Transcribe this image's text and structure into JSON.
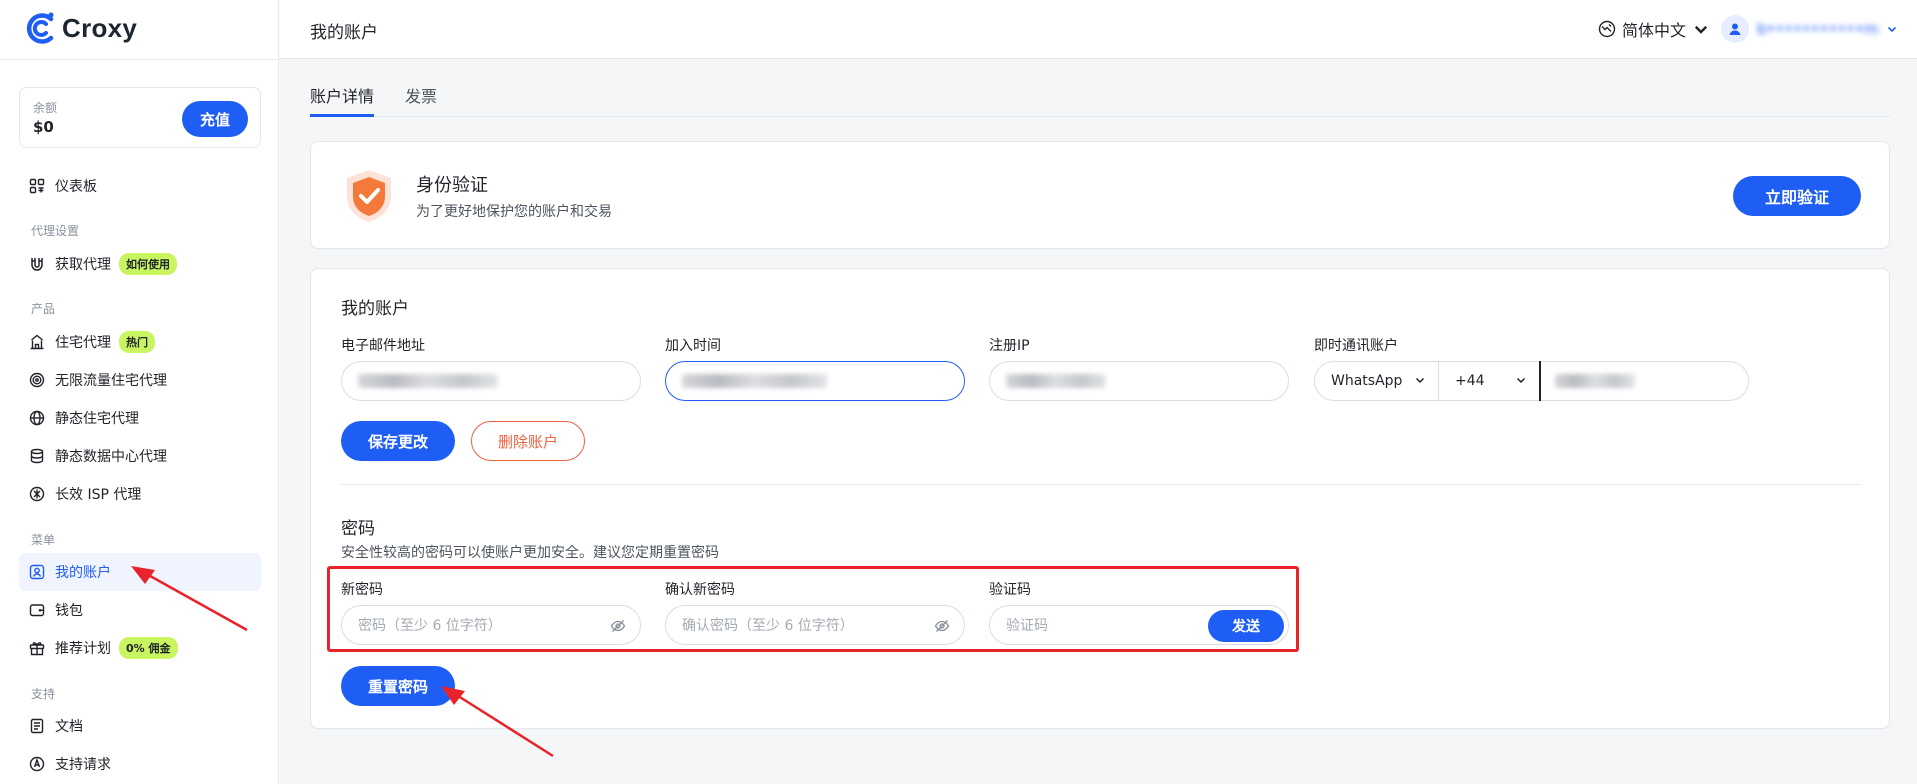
{
  "brand": {
    "name": "Croxy"
  },
  "balance": {
    "label": "余额",
    "value": "$0",
    "recharge_label": "充值"
  },
  "nav": {
    "dashboard": "仪表板",
    "section_proxy": "代理设置",
    "get_proxy": "获取代理",
    "get_proxy_tag": "如何使用",
    "section_product": "产品",
    "residential": "住宅代理",
    "residential_tag": "热门",
    "unlimited": "无限流量住宅代理",
    "static_residential": "静态住宅代理",
    "static_datacenter": "静态数据中心代理",
    "isp": "长效 ISP 代理",
    "section_menu": "菜单",
    "my_account": "我的账户",
    "wallet": "钱包",
    "referral": "推荐计划",
    "referral_tag": "0% 佣金",
    "section_support": "支持",
    "docs": "文档",
    "support": "支持请求"
  },
  "header": {
    "title": "我的账户",
    "language": "简体中文",
    "user_email": "b•••••••••••m"
  },
  "tabs": [
    {
      "label": "账户详情",
      "active": true
    },
    {
      "label": "发票",
      "active": false
    }
  ],
  "verification": {
    "title": "身份验证",
    "subtitle": "为了更好地保护您的账户和交易",
    "button": "立即验证"
  },
  "account": {
    "title": "我的账户",
    "email_label": "电子邮件地址",
    "joined_label": "加入时间",
    "ip_label": "注册IP",
    "im_label": "即时通讯账户",
    "im_app": "WhatsApp",
    "phone_code": "+44",
    "save_label": "保存更改",
    "delete_label": "删除账户"
  },
  "password": {
    "title": "密码",
    "hint": "安全性较高的密码可以使账户更加安全。建议您定期重置密码",
    "new_label": "新密码",
    "new_placeholder": "密码（至少 6 位字符）",
    "confirm_label": "确认新密码",
    "confirm_placeholder": "确认密码（至少 6 位字符）",
    "code_label": "验证码",
    "code_placeholder": "验证码",
    "send_label": "发送",
    "reset_label": "重置密码"
  },
  "colors": {
    "primary": "#1f5ef5",
    "danger": "#f0613f",
    "tag_lime": "#c8f560",
    "annotation_red": "#e8232a"
  }
}
